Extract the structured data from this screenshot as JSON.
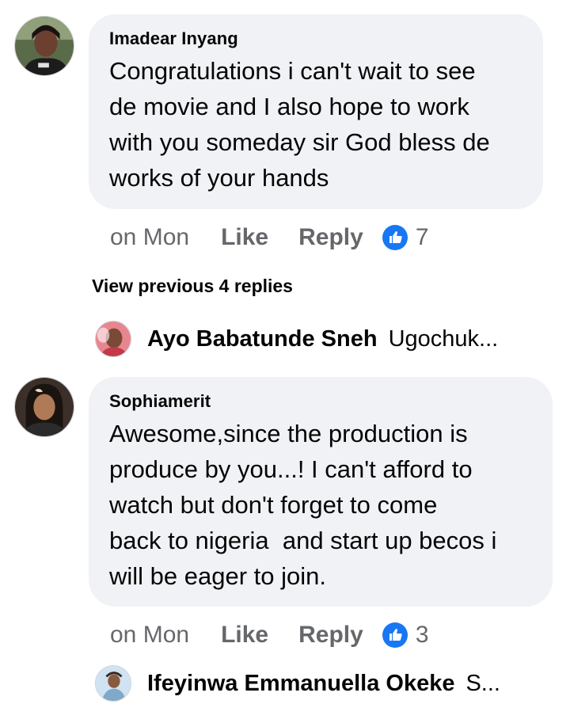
{
  "comments": [
    {
      "author": "Imadear Inyang",
      "text": "Congratulations i can't wait to see\nde movie and I also hope to work\nwith you someday sir God bless de\nworks of your hands",
      "time": "on Mon",
      "like_label": "Like",
      "reply_label": "Reply",
      "reaction_icon": "thumbs-up-icon",
      "reaction_count": "7"
    },
    {
      "author": "Sophiamerit",
      "text": "Awesome,since the production is\nproduce by you...! I can't afford to\nwatch but don't forget to come\nback to nigeria  and start up becos i\nwill be eager to join.",
      "time": "on Mon",
      "like_label": "Like",
      "reply_label": "Reply",
      "reaction_icon": "thumbs-up-icon",
      "reaction_count": "3"
    }
  ],
  "view_previous_label": "View previous 4 replies",
  "replies": [
    {
      "name": "Ayo Babatunde Sneh",
      "preview": "Ugochuk..."
    },
    {
      "name": "Ifeyinwa Emmanuella Okeke",
      "preview": "S..."
    }
  ],
  "colors": {
    "bubble_bg": "#f0f2f5",
    "meta_text": "#65676b",
    "like_blue": "#1877f2"
  }
}
